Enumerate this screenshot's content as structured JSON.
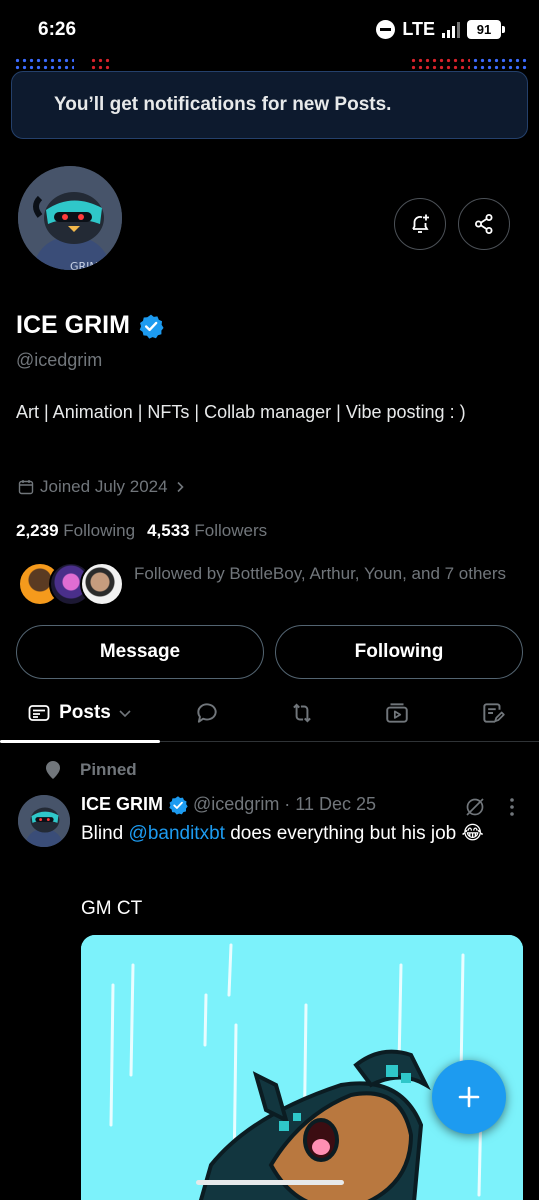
{
  "status_bar": {
    "time": "6:26",
    "network": "LTE",
    "battery": "91"
  },
  "toast": {
    "text": "You’ll get notifications for new Posts."
  },
  "profile": {
    "name": "ICE GRIM",
    "handle": "@icedgrim",
    "bio": "Art | Animation | NFTs | Collab manager | Vibe posting : )",
    "joined": "Joined July 2024",
    "following_count": "2,239",
    "following_label": "Following",
    "followers_count": "4,533",
    "followers_label": "Followers",
    "followed_by": "Followed by BottleBoy, Arthur, Youn, and 7 others"
  },
  "actions": {
    "message": "Message",
    "following": "Following"
  },
  "tabs": {
    "posts": "Posts"
  },
  "post": {
    "pinned_label": "Pinned",
    "author": "ICE GRIM",
    "meta": "@icedgrim · 11 Dec 25",
    "text_before": "Blind ",
    "mention": "@banditxbt",
    "text_after": " does everything but his job 😂",
    "text2": "GM CT"
  },
  "colors": {
    "accent": "#1d9bf0",
    "muted": "#71767b",
    "background": "#000000"
  }
}
